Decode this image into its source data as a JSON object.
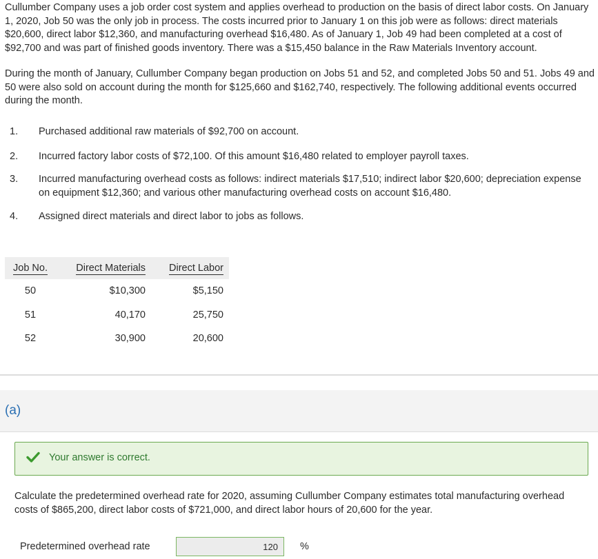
{
  "intro": {
    "paragraph1": "Cullumber Company uses a job order cost system and applies overhead to production on the basis of direct labor costs. On January 1, 2020, Job 50 was the only job in process. The costs incurred prior to January 1 on this job were as follows: direct materials $20,600, direct labor $12,360, and manufacturing overhead $16,480. As of January 1, Job 49 had been completed at a cost of $92,700 and was part of finished goods inventory. There was a $15,450 balance in the Raw Materials Inventory account.",
    "paragraph2": "During the month of January, Cullumber Company began production on Jobs 51 and 52, and completed Jobs 50 and 51. Jobs 49 and 50 were also sold on account during the month for $125,660 and $162,740, respectively. The following additional events occurred during the month."
  },
  "events": [
    {
      "num": "1.",
      "text": "Purchased additional raw materials of $92,700 on account."
    },
    {
      "num": "2.",
      "text": "Incurred factory labor costs of $72,100. Of this amount $16,480 related to employer payroll taxes."
    },
    {
      "num": "3.",
      "text": "Incurred manufacturing overhead costs as follows: indirect materials $17,510; indirect labor $20,600; depreciation expense on equipment $12,360; and various other manufacturing overhead costs on account $16,480."
    },
    {
      "num": "4.",
      "text": "Assigned direct materials and direct labor to jobs as follows."
    }
  ],
  "jobs_table": {
    "headers": [
      "Job No.",
      "Direct Materials",
      "Direct Labor"
    ],
    "rows": [
      [
        "50",
        "$10,300",
        "$5,150"
      ],
      [
        "51",
        "40,170",
        "25,750"
      ],
      [
        "52",
        "30,900",
        "20,600"
      ]
    ]
  },
  "part": {
    "label": "(a)",
    "feedback": "Your answer is correct.",
    "question": "Calculate the predetermined overhead rate for 2020, assuming Cullumber Company estimates total manufacturing overhead costs of $865,200, direct labor costs of $721,000, and direct labor hours of 20,600 for the year.",
    "rate_label": "Predetermined overhead rate",
    "rate_value": "120",
    "rate_unit": "%"
  },
  "colors": {
    "success_bg": "#e8f4e0",
    "success_border": "#6aa84f",
    "check": "#3c9a2e",
    "part_label": "#2a6fb3"
  },
  "icons": {
    "feedback_icon": "check-icon"
  }
}
